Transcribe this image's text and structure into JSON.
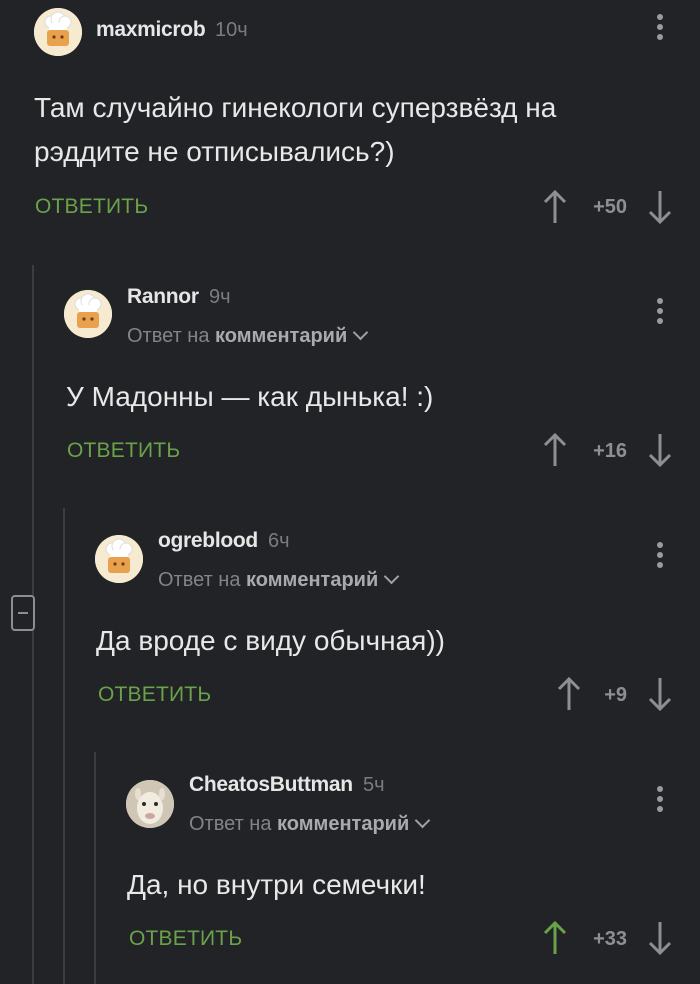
{
  "comments": [
    {
      "author": "maxmicrob",
      "time": "10ч",
      "text_line1": "Там случайно гинекологи суперзвёзд на",
      "text_line2": "рэддите не отписывались?)",
      "reply_label": "ОТВЕТИТЬ",
      "rating": "+50",
      "avatar_icon": "chef-avatar-icon"
    },
    {
      "author": "Rannor",
      "time": "9ч",
      "reply_prefix": "Ответ на",
      "reply_target": "комментарий",
      "text_line1": "У Мадонны — как дынька! :)",
      "reply_label": "ОТВЕТИТЬ",
      "rating": "+16",
      "avatar_icon": "chef-avatar-icon"
    },
    {
      "author": "ogreblood",
      "time": "6ч",
      "reply_prefix": "Ответ на",
      "reply_target": "комментарий",
      "text_line1": "Да вроде с виду обычная))",
      "reply_label": "ОТВЕТИТЬ",
      "rating": "+9",
      "avatar_icon": "chef-avatar-icon"
    },
    {
      "author": "CheatosButtman",
      "time": "5ч",
      "reply_prefix": "Ответ на",
      "reply_target": "комментарий",
      "text_line1": "Да, но внутри семечки!",
      "reply_label": "ОТВЕТИТЬ",
      "rating": "+33",
      "avatar_icon": "alpaca-avatar-icon",
      "upvoted": true
    }
  ],
  "colors": {
    "background": "#222326",
    "accent_green": "#6aa24a",
    "muted": "#8e8f93"
  }
}
